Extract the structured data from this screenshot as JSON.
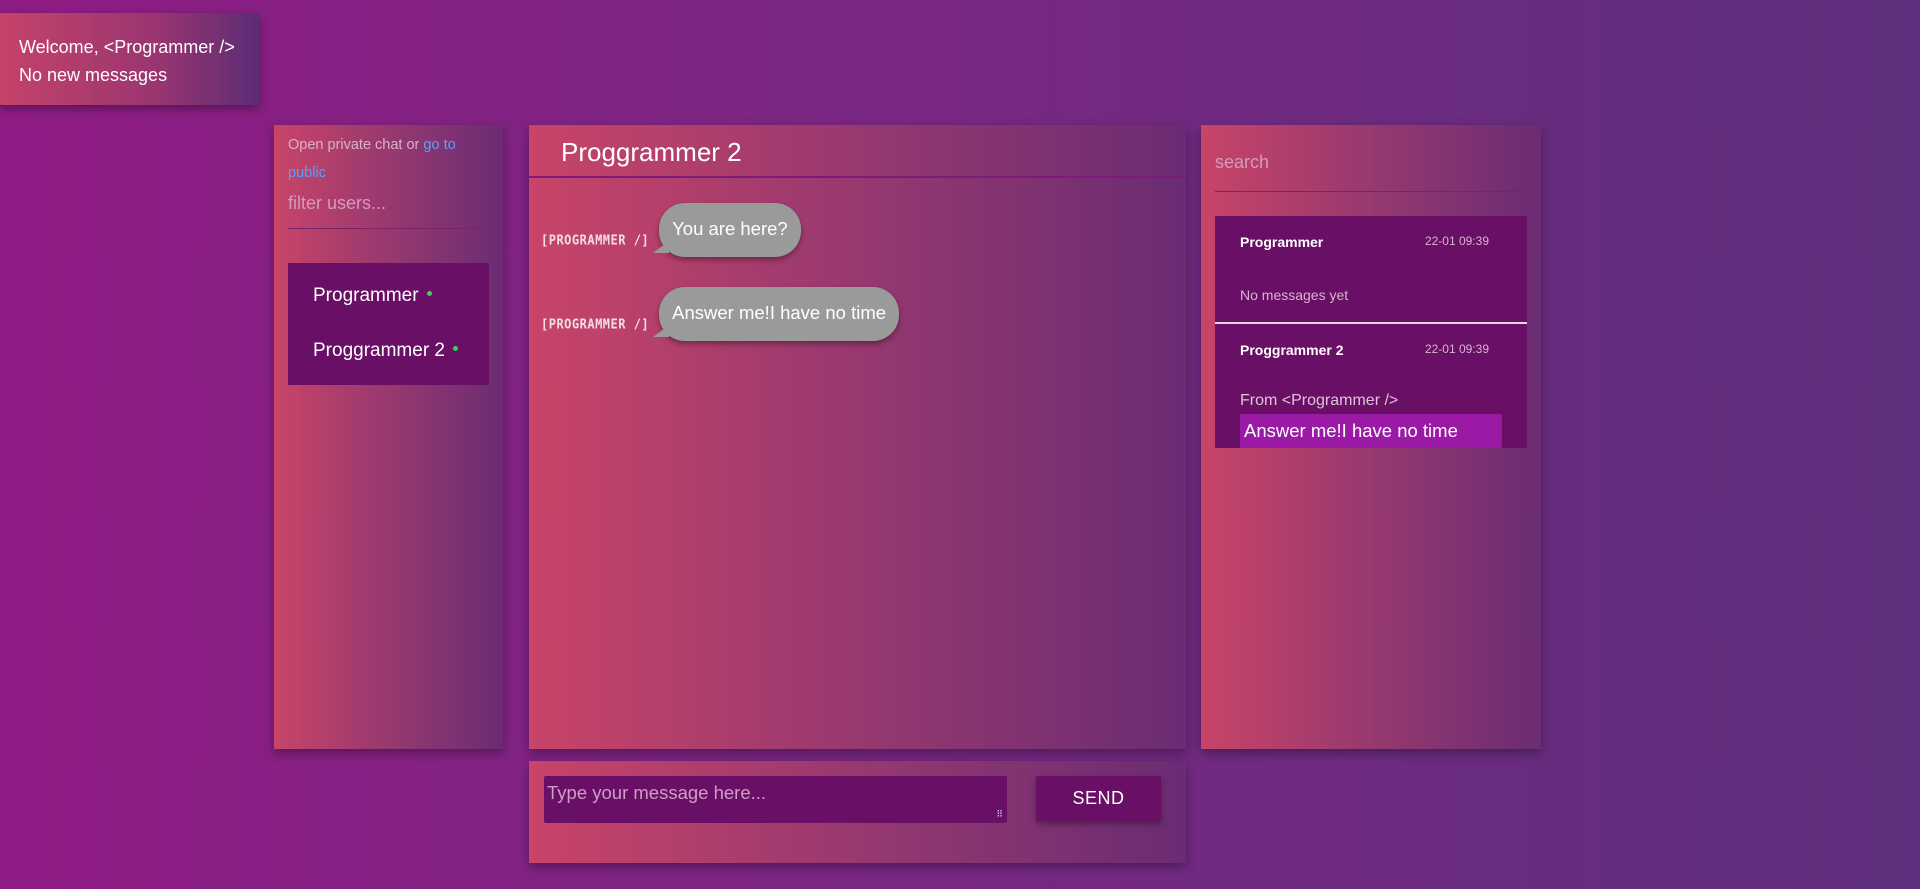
{
  "welcome": {
    "line1": "Welcome, <Programmer />",
    "line2": "No new messages"
  },
  "users_panel": {
    "hint_prefix": "Open private chat or ",
    "hint_link": "go to public",
    "filter_placeholder": "filter users...",
    "users": [
      {
        "name": "Programmer",
        "online": true
      },
      {
        "name": "Proggrammer 2",
        "online": true
      }
    ]
  },
  "chat": {
    "title": "Proggrammer 2",
    "messages": [
      {
        "sender": "[PROGRAMMER /]",
        "text": "You are here?"
      },
      {
        "sender": "[PROGRAMMER /]",
        "text": "Answer me!I have no time"
      }
    ]
  },
  "conversations": {
    "search_placeholder": "search",
    "items": [
      {
        "name": "Programmer",
        "time": "22-01 09:39",
        "status": "No messages yet"
      },
      {
        "name": "Proggrammer 2",
        "time": "22-01 09:39",
        "from": "From <Programmer />",
        "preview": "Answer me!I have no time"
      }
    ]
  },
  "composer": {
    "placeholder": "Type your message here...",
    "send_label": "SEND"
  },
  "colors": {
    "accent": "#6a0f66",
    "highlight": "#9a1aa6",
    "online_dot": "#39d353",
    "link": "#4fa6ff"
  }
}
